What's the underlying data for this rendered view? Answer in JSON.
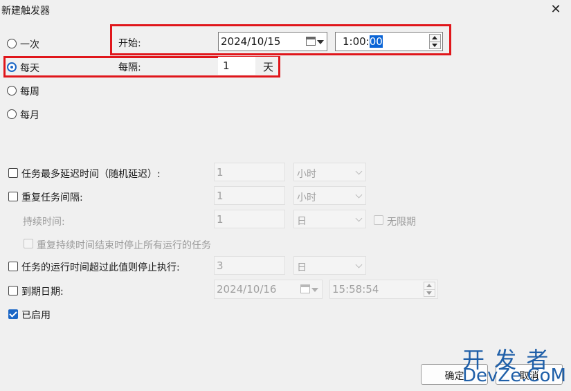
{
  "dialog": {
    "title": "新建触发器",
    "close_symbol": "✕"
  },
  "schedule": {
    "options": [
      {
        "label": "一次",
        "checked": false
      },
      {
        "label": "每天",
        "checked": true
      },
      {
        "label": "每周",
        "checked": false
      },
      {
        "label": "每月",
        "checked": false
      }
    ]
  },
  "start": {
    "label": "开始:",
    "date": "2024/10/15",
    "time_prefix": "1:00:",
    "time_selected": "00"
  },
  "interval": {
    "label": "每隔:",
    "value": "1",
    "unit": "天"
  },
  "advanced": {
    "delay": {
      "label": "任务最多延迟时间（随机延迟）:",
      "checked": false,
      "value": "1",
      "unit": "小时"
    },
    "repeat": {
      "label": "重复任务间隔:",
      "checked": false,
      "value": "1",
      "unit": "小时"
    },
    "duration": {
      "label": "持续时间:",
      "value": "1",
      "unit": "日"
    },
    "indefinite": {
      "label": "无限期",
      "checked": false
    },
    "stop_at_end": {
      "label": "重复持续时间结束时停止所有运行的任务",
      "checked": false
    },
    "stop_if_longer": {
      "label": "任务的运行时间超过此值则停止执行:",
      "checked": false,
      "value": "3",
      "unit": "日"
    },
    "expire": {
      "label": "到期日期:",
      "checked": false,
      "date": "2024/10/16",
      "time": "15:58:54"
    },
    "enabled": {
      "label": "已启用",
      "checked": true
    }
  },
  "buttons": {
    "ok": "确定",
    "cancel": "取消"
  },
  "watermark": {
    "line1": "开 发 者",
    "line2": "DevZe.CoM"
  },
  "colors": {
    "highlight": "#e0161b",
    "accent": "#1a66c6",
    "selection": "#0a64d6"
  }
}
